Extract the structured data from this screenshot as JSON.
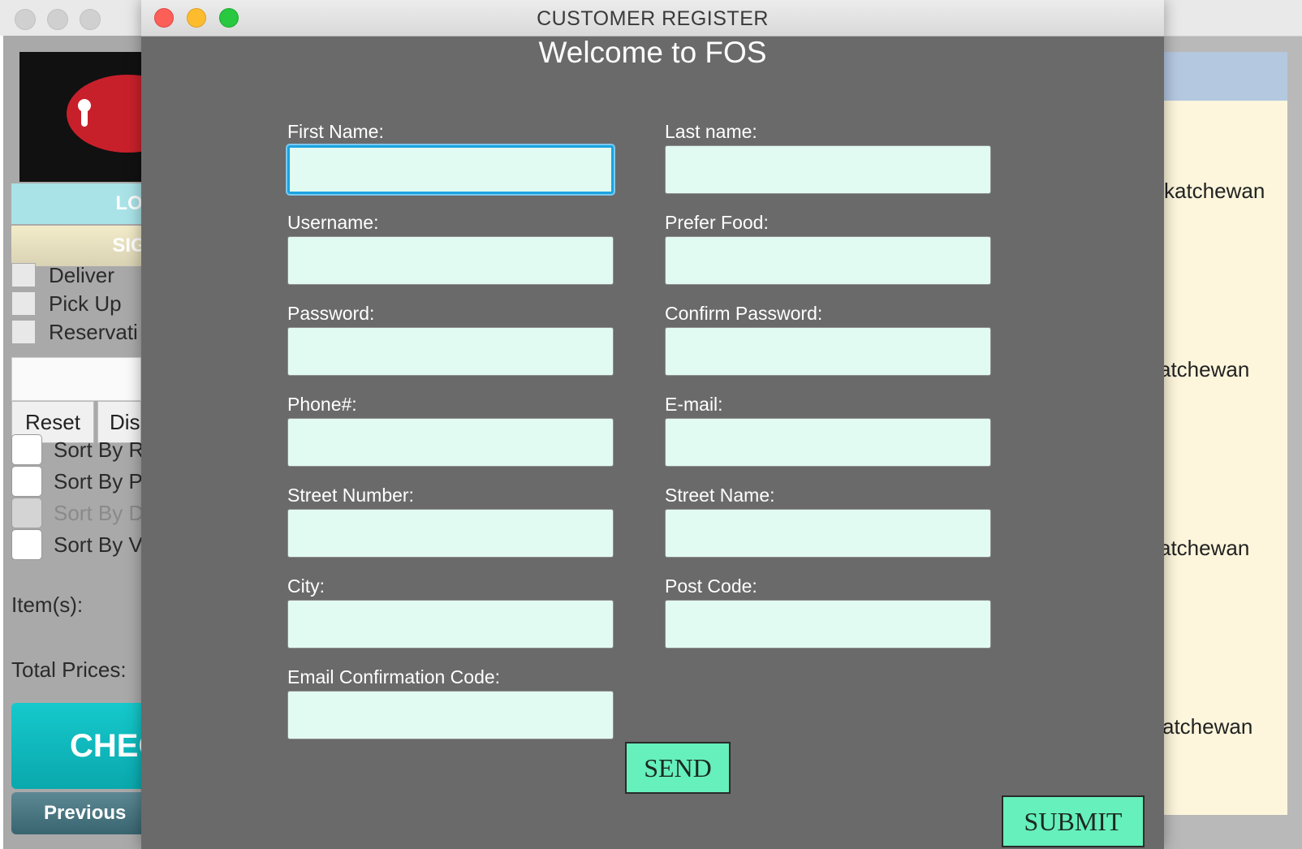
{
  "background_window": {
    "left_panel": {
      "login_label": "LO",
      "signup_label": "SIG",
      "delivery_options": [
        "Deliver",
        "Pick Up",
        "Reservati"
      ],
      "reset_label": "Reset",
      "dis_label": "Dis",
      "sort_options": [
        "Sort By R",
        "Sort By P",
        "Sort By D",
        "Sort By V"
      ],
      "items_label": "Item(s):",
      "total_label": "Total Prices:",
      "checkout_label": "CHEC",
      "previous_label": "Previous"
    },
    "right_panel": {
      "rows": [
        "katchewan",
        "atchewan",
        "atchewan",
        "atchewan"
      ]
    }
  },
  "dialog": {
    "title": "CUSTOMER REGISTER",
    "welcome": "Welcome to FOS",
    "fields": {
      "first_name": {
        "label": "First Name:",
        "value": ""
      },
      "last_name": {
        "label": "Last name:",
        "value": ""
      },
      "username": {
        "label": "Username:",
        "value": ""
      },
      "prefer_food": {
        "label": "Prefer Food:",
        "value": ""
      },
      "password": {
        "label": "Password:",
        "value": ""
      },
      "confirm_password": {
        "label": "Confirm Password:",
        "value": ""
      },
      "phone": {
        "label": "Phone#:",
        "value": ""
      },
      "email": {
        "label": "E-mail:",
        "value": ""
      },
      "street_number": {
        "label": "Street Number:",
        "value": ""
      },
      "street_name": {
        "label": "Street Name:",
        "value": ""
      },
      "city": {
        "label": "City:",
        "value": ""
      },
      "post_code": {
        "label": "Post Code:",
        "value": ""
      },
      "email_code": {
        "label": "Email Confirmation Code:",
        "value": ""
      }
    },
    "send_label": "SEND",
    "submit_label": "SUBMIT"
  },
  "colors": {
    "dialog_bg": "#6a6a6a",
    "field_bg": "#e2fbf2",
    "button_bg": "#66f0bb",
    "focus_ring": "#1ba4e0"
  }
}
